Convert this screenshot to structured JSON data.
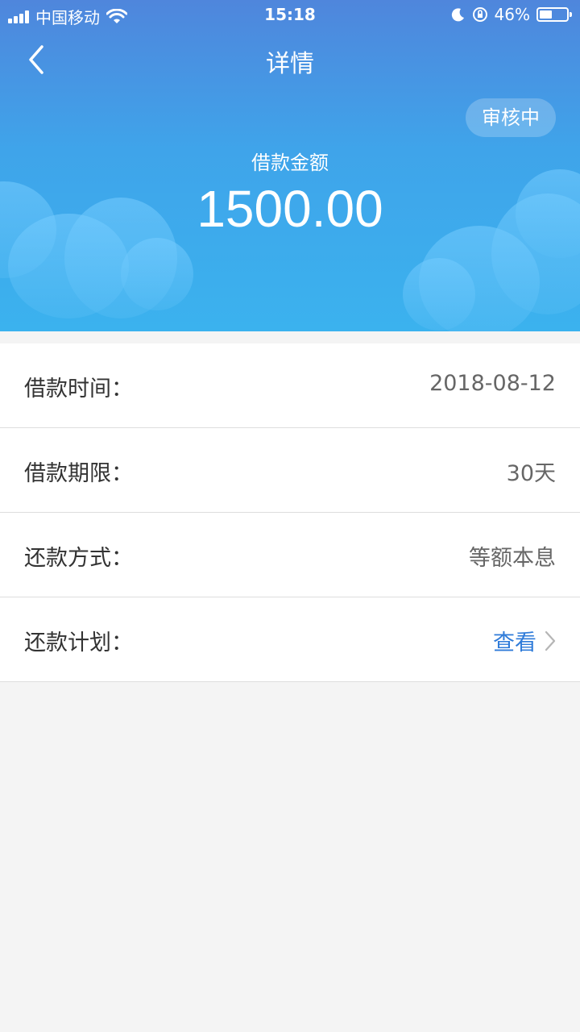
{
  "status_bar": {
    "carrier": "中国移动",
    "time": "15:18",
    "battery_percent": "46%",
    "battery_level": 0.46
  },
  "nav": {
    "title": "详情"
  },
  "loan": {
    "status": "审核中",
    "amount_label": "借款金额",
    "amount": "1500.00"
  },
  "details": [
    {
      "label": "借款时间：",
      "value": "2018-08-12"
    },
    {
      "label": "借款期限：",
      "value": "30天"
    },
    {
      "label": "还款方式：",
      "value": "等额本息"
    },
    {
      "label": "还款计划：",
      "link": "查看"
    }
  ],
  "colors": {
    "link": "#2f7bd9",
    "header_top": "#4f86dc",
    "header_bottom": "#3bb2ee"
  }
}
